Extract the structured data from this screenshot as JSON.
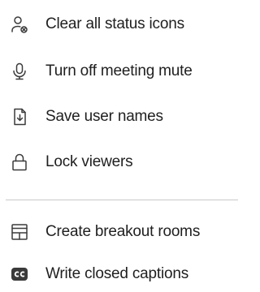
{
  "menu": {
    "items": [
      {
        "label": "Clear all status icons",
        "icon": "clear-status-icon"
      },
      {
        "label": "Turn off meeting mute",
        "icon": "microphone-icon"
      },
      {
        "label": "Save user names",
        "icon": "save-download-icon"
      },
      {
        "label": "Lock viewers",
        "icon": "lock-icon"
      }
    ],
    "items_after_divider": [
      {
        "label": "Create breakout rooms",
        "icon": "breakout-rooms-icon"
      },
      {
        "label": "Write closed captions",
        "icon": "closed-captions-icon"
      }
    ]
  },
  "colors": {
    "icon_stroke": "#3a3a3a",
    "text": "#1f1f1f",
    "divider": "#c9c9c9"
  }
}
